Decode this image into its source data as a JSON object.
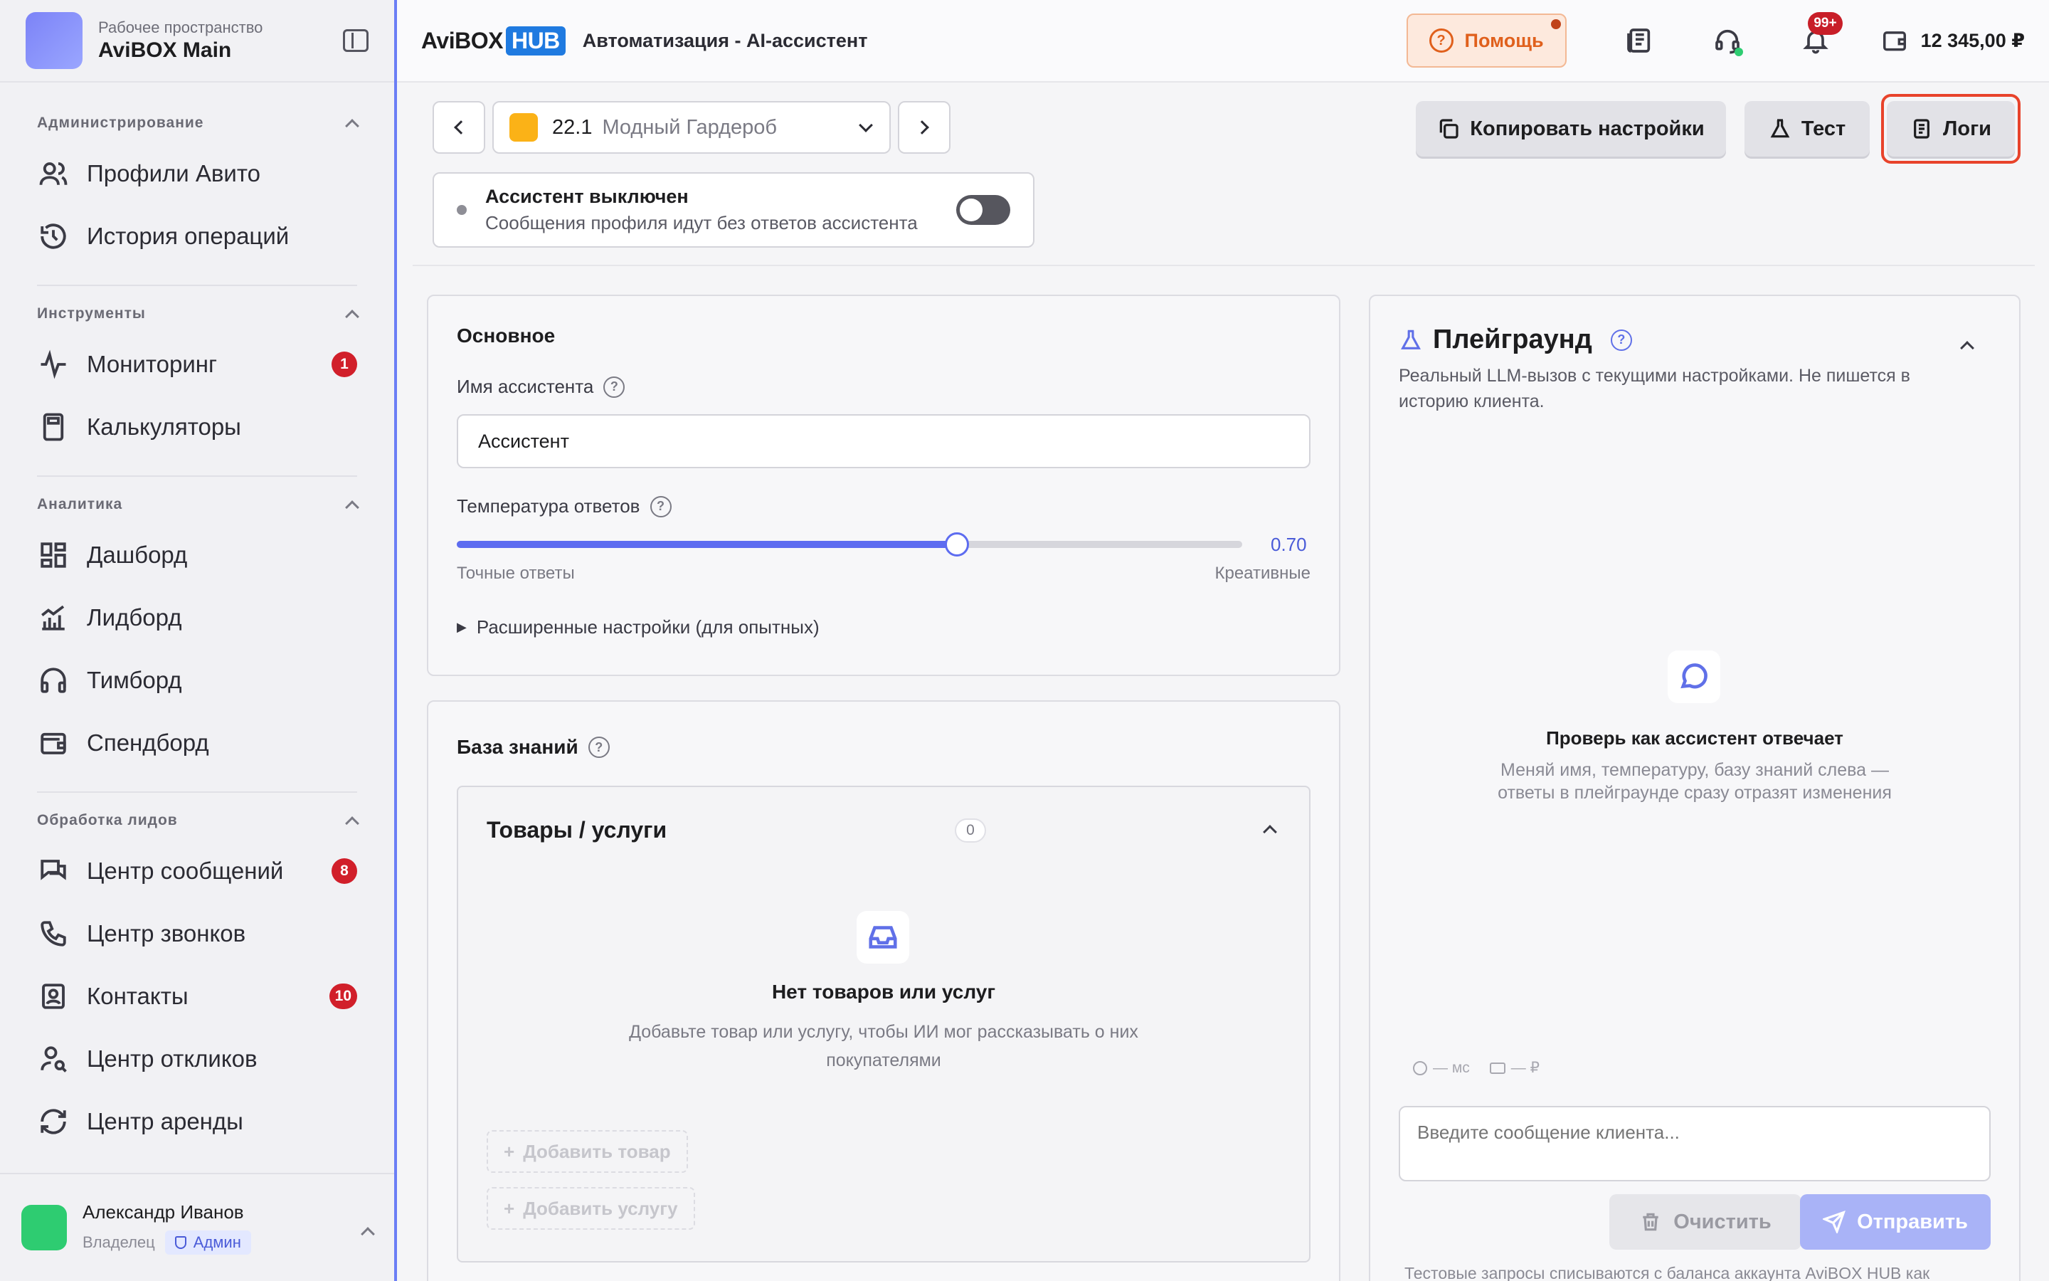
{
  "workspace": {
    "label": "Рабочее пространство",
    "name": "AviBOX Main"
  },
  "sidebar": {
    "sections": [
      {
        "title": "Администрирование",
        "items": [
          {
            "label": "Профили Авито",
            "icon": "users-icon"
          },
          {
            "label": "История операций",
            "icon": "history-icon"
          }
        ]
      },
      {
        "title": "Инструменты",
        "items": [
          {
            "label": "Мониторинг",
            "icon": "activity-icon",
            "badge": "1"
          },
          {
            "label": "Калькуляторы",
            "icon": "calculator-icon"
          }
        ]
      },
      {
        "title": "Аналитика",
        "items": [
          {
            "label": "Дашборд",
            "icon": "dashboard-icon"
          },
          {
            "label": "Лидборд",
            "icon": "bar-chart-icon"
          },
          {
            "label": "Тимборд",
            "icon": "headphones-icon"
          },
          {
            "label": "Спендборд",
            "icon": "wallet-icon"
          }
        ]
      },
      {
        "title": "Обработка лидов",
        "items": [
          {
            "label": "Центр сообщений",
            "icon": "messages-icon",
            "badge": "8"
          },
          {
            "label": "Центр звонков",
            "icon": "phone-icon"
          },
          {
            "label": "Контакты",
            "icon": "contacts-icon",
            "badge": "10"
          },
          {
            "label": "Центр откликов",
            "icon": "user-search-icon"
          },
          {
            "label": "Центр аренды",
            "icon": "refresh-icon"
          }
        ]
      }
    ]
  },
  "user": {
    "name": "Александр Иванов",
    "role": "Владелец",
    "chip": "Админ"
  },
  "topbar": {
    "brand_main": "AviBOX",
    "brand_hub": "HUB",
    "breadcrumb": "Автоматизация - AI-ассистент",
    "help": "Помощь",
    "notif_count": "99+",
    "balance": "12 345,00 ₽"
  },
  "toolbar": {
    "profile_num": "22.1",
    "profile_name": "Модный Гардероб",
    "copy": "Копировать настройки",
    "test": "Тест",
    "logs": "Логи"
  },
  "status": {
    "title": "Ассистент выключен",
    "subtitle": "Сообщения профиля идут без ответов ассистента",
    "enabled": false
  },
  "basic": {
    "title": "Основное",
    "name_label": "Имя ассистента",
    "name_value": "Ассистент",
    "temp_label": "Температура ответов",
    "temp_value": 0.7,
    "temp_display": "0.70",
    "temp_min_label": "Точные ответы",
    "temp_max_label": "Креативные",
    "advanced": "Расширенные настройки (для опытных)"
  },
  "kb": {
    "title": "База знаний",
    "group_title": "Товары / услуги",
    "group_count": "0",
    "empty_title": "Нет товаров или услуг",
    "empty_text": "Добавьте товар или услугу, чтобы ИИ мог рассказывать о них покупателями",
    "add_product": "Добавить товар",
    "add_service": "Добавить услугу"
  },
  "playground": {
    "title": "Плейграунд",
    "desc": "Реальный LLM-вызов с текущими настройками. Не пишется в историю клиента.",
    "empty_title": "Проверь как ассистент отвечает",
    "empty_text": "Меняй имя, температуру, базу знаний слева — ответы в плейграунде сразу отразят изменения",
    "latency": "— мс",
    "cost": "— ₽",
    "input_placeholder": "Введите сообщение клиента...",
    "clear": "Очистить",
    "send": "Отправить",
    "footer": "Тестовые запросы списываются с баланса аккаунта AviBOX HUB как"
  }
}
